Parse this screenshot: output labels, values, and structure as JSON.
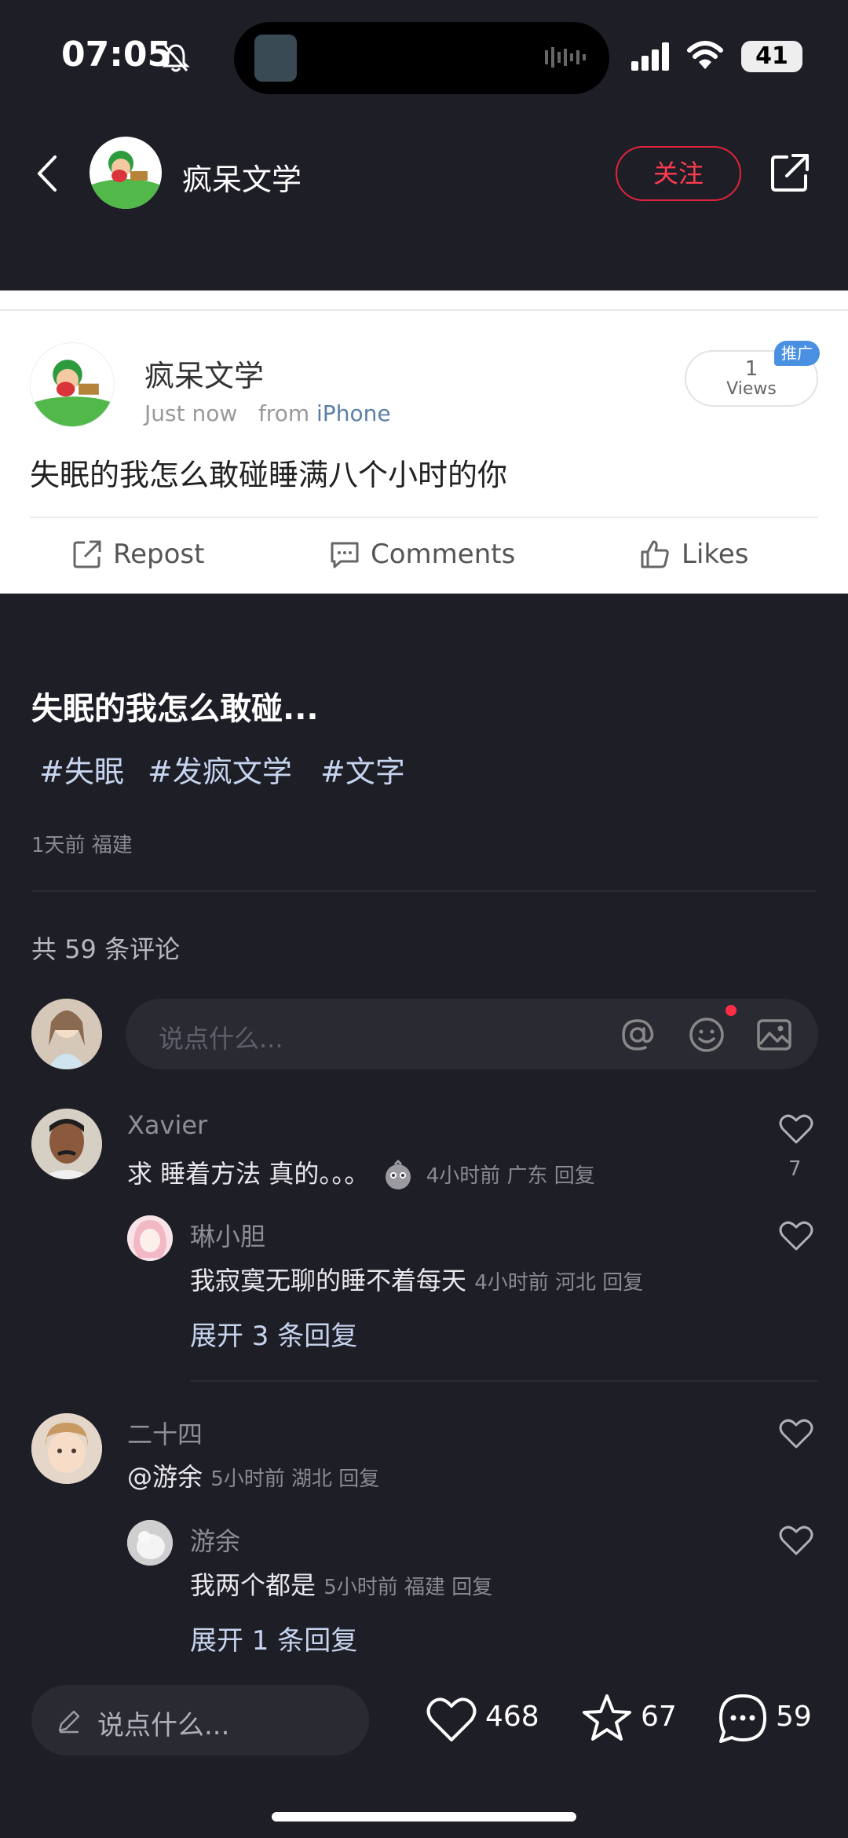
{
  "status_bar": {
    "time": "07:05",
    "battery": "41"
  },
  "header": {
    "title": "疯呆文学",
    "follow_label": "关注"
  },
  "card": {
    "author": "疯呆文学",
    "time": "Just now",
    "from_prefix": "from",
    "source": "iPhone",
    "views_count": "1",
    "views_label": "Views",
    "badge": "推广",
    "text": "失眠的我怎么敢碰睡满八个小时的你",
    "actions": {
      "repost": "Repost",
      "comments": "Comments",
      "likes": "Likes"
    }
  },
  "post": {
    "title": "失眠的我怎么敢碰...",
    "tags": [
      "#失眠",
      "#发疯文学",
      "#文字"
    ],
    "meta": "1天前 福建"
  },
  "comments_section": {
    "count_label": "共 59 条评论",
    "input_placeholder": "说点什么..."
  },
  "comments": [
    {
      "name": "Xavier",
      "text": "求 睡着方法 真的。。。",
      "meta": "4小时前 广东 回复",
      "likes": "7",
      "reply": {
        "name": "琳小胆",
        "text": "我寂寞无聊的睡不着每天",
        "meta": "4小时前 河北 回复"
      },
      "expand": "展开 3 条回复"
    },
    {
      "name": "二十四",
      "text": "@游余",
      "meta": "5小时前 湖北 回复",
      "reply": {
        "name": "游余",
        "text": "我两个都是",
        "meta": "5小时前 福建 回复"
      },
      "expand": "展开 1 条回复"
    }
  ],
  "bottom_bar": {
    "placeholder": "说点什么...",
    "likes": "468",
    "favorites": "67",
    "comments": "59"
  },
  "colors": {
    "accent": "#ff3b4f",
    "tag": "#c6d4ef",
    "background": "#1e1e26"
  }
}
